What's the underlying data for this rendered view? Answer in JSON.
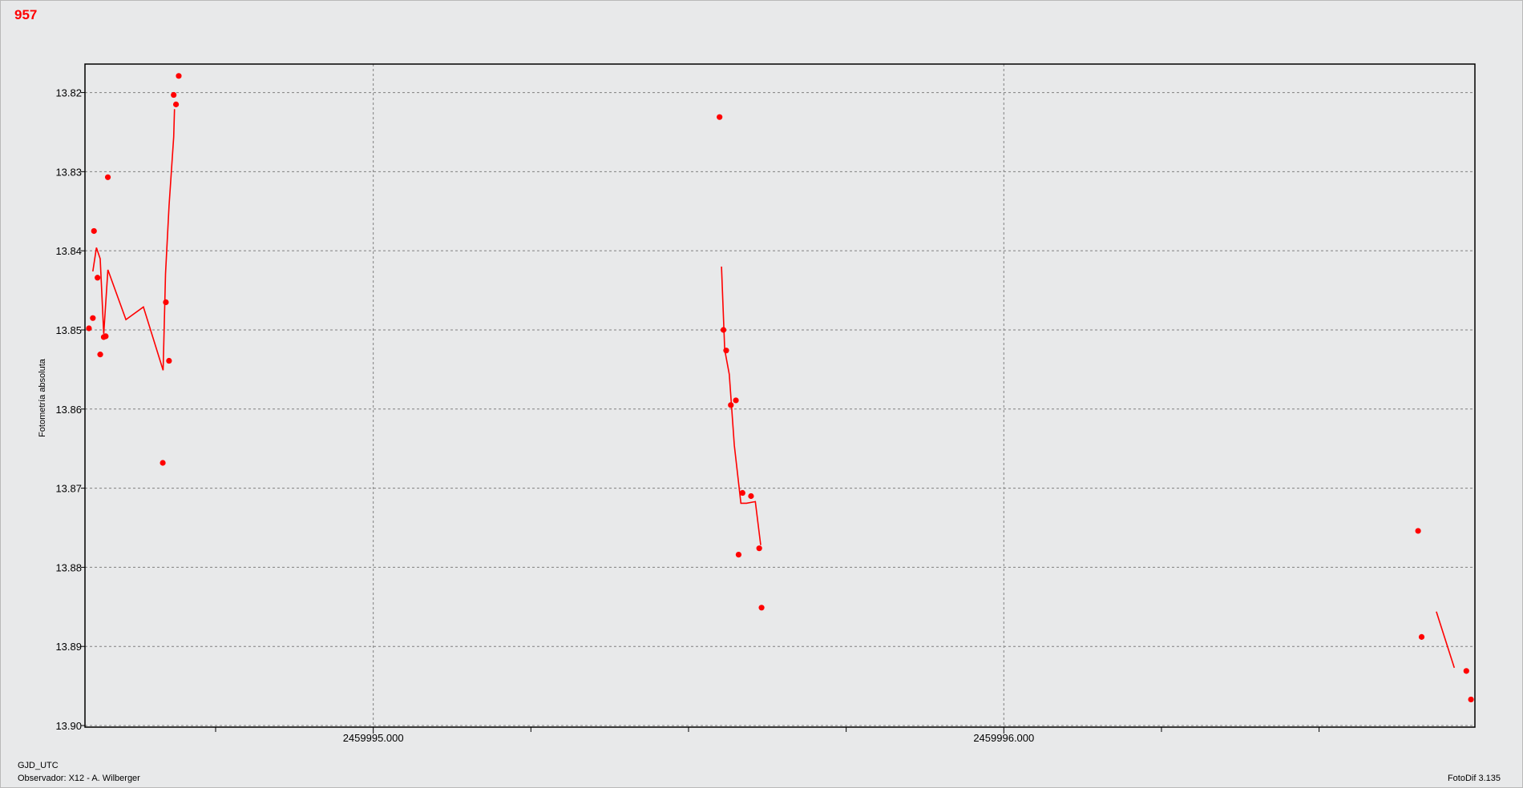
{
  "header": {
    "id_label": "957"
  },
  "footer": {
    "xlabel": "GJD_UTC",
    "observer": "Observador: X12 - A. Wilberger",
    "software": "FotoDif 3.135"
  },
  "colors": {
    "series": "#ff0000",
    "grid": "#808080",
    "axis": "#000000",
    "background": "#e8e9ea"
  },
  "chart_data": {
    "type": "scatter",
    "title": "957",
    "xlabel": "GJD_UTC",
    "ylabel": "Fotometría absoluta",
    "y_inverted": true,
    "xlim": [
      2459994.5428,
      2459996.7471
    ],
    "ylim": [
      13.9002,
      13.8164
    ],
    "grid": true,
    "x_ticks": [
      2459995.0,
      2459996.0
    ],
    "x_tick_labels": [
      "2459995.000",
      "2459996.000"
    ],
    "x_minor_ticks": [
      2459994.75,
      2459995.25,
      2459995.5,
      2459995.75,
      2459996.25,
      2459996.5
    ],
    "y_ticks": [
      13.82,
      13.83,
      13.84,
      13.85,
      13.86,
      13.87,
      13.88,
      13.89,
      13.9
    ],
    "y_tick_labels": [
      "13.82",
      "13.83",
      "13.84",
      "13.85",
      "13.86",
      "13.87",
      "13.88",
      "13.89",
      "13.90"
    ],
    "series": [
      {
        "kind": "points",
        "x": [
          2459994.5491,
          2459994.5553,
          2459994.5571,
          2459994.5627,
          2459994.567,
          2459994.5726,
          2459994.5757,
          2459994.5791,
          2459994.6662,
          2459994.6711,
          2459994.6761,
          2459994.6835,
          2459994.6872,
          2459994.6915,
          2459995.5492,
          2459995.5554,
          2459995.5597,
          2459995.5671,
          2459995.5751,
          2459995.5794,
          2459995.5856,
          2459995.5991,
          2459995.6121,
          2459995.6158,
          2459996.657,
          2459996.6626,
          2459996.7335,
          2459996.7409
        ],
        "y": [
          13.8498,
          13.8485,
          13.8375,
          13.8434,
          13.8531,
          13.8509,
          13.8508,
          13.8307,
          13.8668,
          13.8465,
          13.8539,
          13.8203,
          13.8215,
          13.8179,
          13.8231,
          13.85,
          13.8526,
          13.8595,
          13.8589,
          13.8784,
          13.8706,
          13.871,
          13.8776,
          13.8851,
          13.8754,
          13.8888,
          13.8931,
          13.8967
        ]
      },
      {
        "kind": "line",
        "segments": [
          {
            "x": [
              2459994.5553,
              2459994.561,
              2459994.567,
              2459994.5726,
              2459994.5791,
              2459994.6077,
              2459994.6355,
              2459994.6668,
              2459994.6705,
              2459994.6761,
              2459994.6835,
              2459994.6848
            ],
            "y": [
              13.8426,
              13.8396,
              13.841,
              13.8505,
              13.8424,
              13.8487,
              13.8471,
              13.8551,
              13.8429,
              13.8343,
              13.8256,
              13.8221
            ]
          },
          {
            "x": [
              2459995.5523,
              2459995.5573,
              2459995.5646,
              2459995.5726,
              2459995.5831,
              2459995.5918,
              2459995.6059,
              2459995.6145
            ],
            "y": [
              13.842,
              13.8525,
              13.8556,
              13.8646,
              13.8719,
              13.8719,
              13.8717,
              13.8772
            ]
          },
          {
            "x": [
              2459996.686,
              2459996.7144
            ],
            "y": [
              13.8856,
              13.8927
            ]
          }
        ]
      }
    ]
  }
}
